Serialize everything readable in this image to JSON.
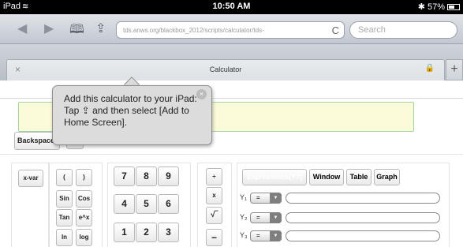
{
  "status": {
    "device": "iPad",
    "time": "10:50 AM",
    "battery": "57%",
    "bluetooth": "✱"
  },
  "toolbar": {
    "url": "tds.anws.org/blackbox_2012/scripts/calculator/tds-",
    "search_placeholder": "Search",
    "back": "◀",
    "forward": "▶",
    "bookmarks": "🕮",
    "share": "⇪",
    "reload": "C"
  },
  "tab": {
    "title": "Calculator",
    "close": "×",
    "new_tab": "+",
    "lock": "🔒"
  },
  "calc": {
    "backspace": "Backspace",
    "xvar": "x-var",
    "func_keys": [
      "(",
      ")",
      "Sin",
      "Cos",
      "Tan",
      "e^x",
      "ln",
      "log"
    ],
    "digits": [
      "7",
      "8",
      "9",
      "4",
      "5",
      "6",
      "1",
      "2",
      "3"
    ],
    "ops": [
      "÷",
      "x",
      "√‾",
      "−"
    ],
    "modes": [
      "Expressions(Y=)",
      "Window",
      "Table",
      "Graph"
    ],
    "y_rows": [
      {
        "label": "Y₁",
        "op": "="
      },
      {
        "label": "Y₂",
        "op": "="
      },
      {
        "label": "Y₃",
        "op": "="
      }
    ]
  },
  "tooltip": {
    "text": "Add this calculator to your iPad: Tap ⇪ and then select [Add to Home Screen].",
    "close": "×"
  }
}
